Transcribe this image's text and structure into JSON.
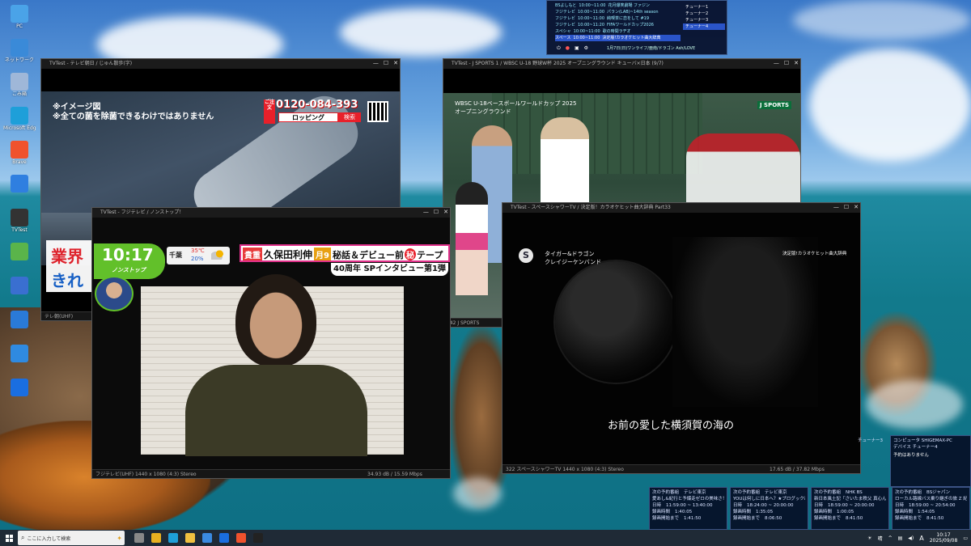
{
  "desktop_icons": [
    {
      "label": "PC",
      "icon": "pc-icon",
      "color": "#4aa3e8"
    },
    {
      "label": "ネットワーク",
      "icon": "network-icon",
      "color": "#3a8ad8"
    },
    {
      "label": "ごみ箱",
      "icon": "recycle-bin-icon",
      "color": "#9fb7d8"
    },
    {
      "label": "Microsoft Edge",
      "icon": "edge-icon",
      "color": "#1e9fd9"
    },
    {
      "label": "Brave",
      "icon": "brave-icon",
      "color": "#f0522d"
    },
    {
      "label": "",
      "icon": "app-icon",
      "color": "#2f7fe0"
    },
    {
      "label": "TVTest",
      "icon": "tvtest-icon",
      "color": "#333333"
    },
    {
      "label": "",
      "icon": "app2-icon",
      "color": "#5ab44a"
    },
    {
      "label": "",
      "icon": "app3-icon",
      "color": "#3a6fd0"
    },
    {
      "label": "",
      "icon": "app4-icon",
      "color": "#2a7ad8"
    },
    {
      "label": "",
      "icon": "app5-icon",
      "color": "#2f8ae0"
    },
    {
      "label": "",
      "icon": "media-icon",
      "color": "#1a6ee0"
    }
  ],
  "win1": {
    "title": "TVTest - テレビ朝日 / じゅん散歩(字)",
    "line1": "※イメージ図",
    "line2": "※全ての菌を除菌できるわけではありません",
    "phone": "0120-084-393",
    "search_word": "ロッピング",
    "search_btn": "検索",
    "side_text1": "業界",
    "side_text2": "きれ",
    "status": "テレ朝(UHF)"
  },
  "win2": {
    "title": "TVTest - J SPORTS 1 / WBSC U-18 野球W杯 2025 オープニングラウンド キューバ×日本 (9/7)",
    "caption1": "WBSC U-18ベースボールワールドカップ 2025",
    "caption2": "オープニングラウンド",
    "logo": "J SPORTS",
    "status": "242 J SPORTS"
  },
  "win3": {
    "title": "TVTest - フジテレビ / ノンストップ！",
    "time": "10:17",
    "brand": "ノンストップ",
    "weather_city": "千葉",
    "temp": "35℃",
    "rain": "20%",
    "headline": "久保田利伸",
    "headline_tag1": "貴重",
    "headline_tag2": "月9",
    "headline_rest": "秘話＆デビュー前",
    "headline_tag3": "秘",
    "headline_tail": "テープ",
    "sub_headline": "40周年 SPインタビュー第1弾",
    "status": "フジテレビ(UHF)   1440 x 1080 (4:3)   Stereo",
    "status_right": "34.93 dB / 15.59 Mbps"
  },
  "win4": {
    "title": "TVTest - スペースシャワーTV / 決定版！カラオケヒット曲大辞典 Part33",
    "artist1": "タイガー&ドラゴン",
    "artist2": "クレイジーケンバンド",
    "program": "決定版!カラオケヒット曲大辞典",
    "subtitle": "お前の愛した横須賀の海の",
    "status": "322 スペースシャワーTV   1440 x 1080 (4:3)   Stereo",
    "status_right": "17.65 dB / 37.82 Mbps"
  },
  "tuner_panel": {
    "rows": [
      {
        "ch": "BSよしもと",
        "time": "10:00~11:00",
        "prog": "花月爆笑劇場 ファジン"
      },
      {
        "ch": "フジテレビ",
        "time": "10:00~11:00",
        "prog": "パラン(LAB)~14th season"
      },
      {
        "ch": "フジテレビ",
        "time": "10:00~11:00",
        "prog": "純喫茶に恋をして #19"
      },
      {
        "ch": "フジテレビ",
        "time": "10:00~11:20",
        "prog": "FIFAワールドカップ2026"
      },
      {
        "ch": "スペシャ",
        "time": "10:00~11:00",
        "prog": "歌の時間ラヂオ"
      },
      {
        "ch": "スペース",
        "time": "10:00~11:00",
        "prog": "決定版!カラオケヒット曲大辞典"
      }
    ],
    "footer": "1月7日(日)ワンライフ/亜南/ドラゴン Ash/LOVE",
    "tuners": [
      "チューナー1",
      "チューナー2",
      "チューナー3",
      "チューナー4"
    ]
  },
  "info_panel": {
    "header_left": "チューナー3",
    "header_right_label1": "コンピュータ",
    "header_right_val1": "SHIGEMAX-PC",
    "header_right_label2": "デバイス",
    "header_right_val2": "チューナー4",
    "no_rec": "予約はありません",
    "cells": [
      {
        "label": "次の予約番組",
        "ch": "テレビ東京",
        "prog": "愛あし&紀行と予爆走ゼロの美味さ！7",
        "date_label": "日時",
        "date": "11:59:00 ~ 13:40:00",
        "rec": "録画時間",
        "rec_val": "1:40:05",
        "until": "録画開始まで",
        "until_val": "1:41:50"
      },
      {
        "label": "次の予約番組",
        "ch": "テレビ東京",
        "prog": "YOUは何しに日本へ？★ブログック出演",
        "date_label": "日時",
        "date": "18:24:00 ~ 20:00:00",
        "rec": "録画時間",
        "rec_val": "1:35:05",
        "until": "録画開始まで",
        "until_val": "8:06:50"
      },
      {
        "label": "次の予約番組",
        "ch": "NHK BS",
        "prog": "新日本風土記「さいたま秩父 真心ん」",
        "date_label": "日時",
        "date": "18:59:00 ~ 20:00:00",
        "rec": "録画時間",
        "rec_val": "1:00:05",
        "until": "録画開始まで",
        "until_val": "8:41:50"
      },
      {
        "label": "次の予約番組",
        "ch": "BSジャパン",
        "prog": "ローカル路線バス乗り継ぎの旅 Z 紀美",
        "date_label": "日時",
        "date": "18:59:00 ~ 20:54:00",
        "rec": "録画時間",
        "rec_val": "1:54:05",
        "until": "録画開始まで",
        "until_val": "8:41:50"
      }
    ]
  },
  "taskbar": {
    "search_placeholder": "ここに入力して検索",
    "weather": "晴",
    "time": "10:17",
    "date": "2025/09/08",
    "ime": "A"
  }
}
